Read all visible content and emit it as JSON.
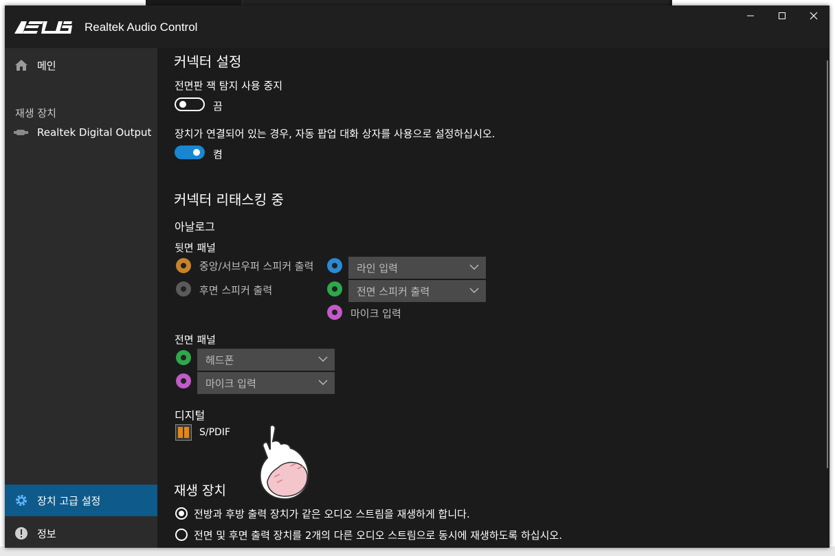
{
  "window": {
    "title": "Realtek Audio Control",
    "brand": "ASUS"
  },
  "sidebar": {
    "main_label": "메인",
    "section_playback": "재생 장치",
    "device_label": "Realtek Digital Output",
    "advanced_label": "장치 고급 설정",
    "info_label": "정보"
  },
  "connector_settings": {
    "heading": "커넥터 설정",
    "jack_detect_label": "전면판 잭 탐지 사용 중지",
    "jack_detect_state": "끔",
    "popup_label": "장치가 연결되어 있는 경우, 자동 팝업 대화 상자를 사용으로 설정하십시오.",
    "popup_state": "켬"
  },
  "retasking": {
    "heading": "커넥터 리태스킹 중",
    "analog_label": "아날로그",
    "rear_panel_label": "뒷면 패널",
    "rear_jacks": [
      {
        "label": "중앙/서브우퍼 스피커 출력",
        "color": "#c8822a"
      },
      {
        "label": "후면 스피커 출력",
        "color": "#5a5a5a"
      }
    ],
    "rear_dropdowns": [
      {
        "value": "라인 입력",
        "color": "#2a8ad4"
      },
      {
        "value": "전면 스피커 출력",
        "color": "#2ea84a"
      }
    ],
    "rear_mic": {
      "label": "마이크 입력",
      "color": "#c25ac8"
    },
    "front_panel_label": "전면 패널",
    "front_dropdowns": [
      {
        "value": "헤드폰",
        "color": "#2ea84a"
      },
      {
        "value": "마이크 입력",
        "color": "#c25ac8"
      }
    ],
    "digital_label": "디지털",
    "spdif_label": "S/PDIF"
  },
  "playback": {
    "heading": "재생 장치",
    "option_same": "전방과 후방 출력 장치가 같은 오디오 스트림을 재생하게 합니다.",
    "option_separate": "전면 및 후면 출력 장치를 2개의 다른 오디오 스트림으로 동시에 재생하도록 하십시오."
  },
  "colors": {
    "accent": "#1a86d0",
    "sidebar_active": "#0e5a8a",
    "background": "#1b1b1b"
  }
}
